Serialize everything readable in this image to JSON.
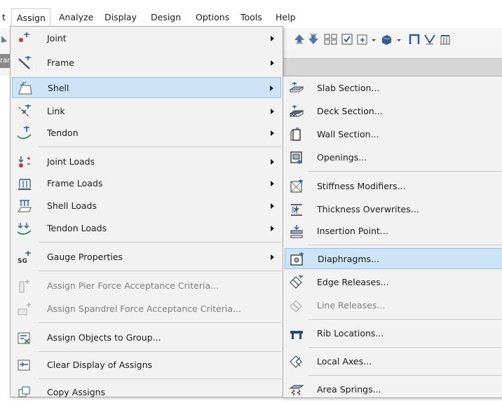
{
  "menubar": {
    "items": [
      {
        "label": "t"
      },
      {
        "label": "Assign"
      },
      {
        "label": "Analyze"
      },
      {
        "label": "Display"
      },
      {
        "label": "Design"
      },
      {
        "label": "Options"
      },
      {
        "label": "Tools"
      },
      {
        "label": "Help"
      }
    ]
  },
  "side_tab": {
    "label": "rar"
  },
  "assign_menu": {
    "items": [
      {
        "label": "Joint",
        "icon": "joint-icon",
        "submenu": true
      },
      {
        "label": "Frame",
        "icon": "frame-icon",
        "submenu": true
      },
      {
        "label": "Shell",
        "icon": "shell-icon",
        "submenu": true,
        "highlighted": true
      },
      {
        "label": "Link",
        "icon": "link-icon",
        "submenu": true
      },
      {
        "label": "Tendon",
        "icon": "tendon-icon",
        "submenu": true
      },
      {
        "label": "Joint Loads",
        "icon": "joint-loads-icon",
        "submenu": true
      },
      {
        "label": "Frame Loads",
        "icon": "frame-loads-icon",
        "submenu": true
      },
      {
        "label": "Shell Loads",
        "icon": "shell-loads-icon",
        "submenu": true
      },
      {
        "label": "Tendon Loads",
        "icon": "tendon-loads-icon",
        "submenu": true
      },
      {
        "label": "Gauge Properties",
        "icon": "gauge-icon",
        "submenu": true
      },
      {
        "label": "Assign Pier Force Acceptance Criteria...",
        "icon": "pier-icon",
        "disabled": true
      },
      {
        "label": "Assign Spandrel Force Acceptance Criteria...",
        "icon": "spandrel-icon",
        "disabled": true
      },
      {
        "label": "Assign Objects to Group...",
        "icon": "group-icon"
      },
      {
        "label": "Clear Display of Assigns",
        "icon": "clear-display-icon"
      },
      {
        "label": "Copy Assigns",
        "icon": "copy-assigns-icon"
      }
    ]
  },
  "shell_submenu": {
    "items": [
      {
        "label": "Slab Section...",
        "icon": "slab-section-icon"
      },
      {
        "label": "Deck Section...",
        "icon": "deck-section-icon"
      },
      {
        "label": "Wall Section...",
        "icon": "wall-section-icon"
      },
      {
        "label": "Openings...",
        "icon": "openings-icon"
      },
      {
        "label": "Stiffness Modifiers...",
        "icon": "stiffness-icon"
      },
      {
        "label": "Thickness Overwrites...",
        "icon": "thickness-icon"
      },
      {
        "label": "Insertion Point...",
        "icon": "insertion-point-icon"
      },
      {
        "label": "Diaphragms...",
        "icon": "diaphragms-icon",
        "highlighted": true
      },
      {
        "label": "Edge Releases...",
        "icon": "edge-releases-icon"
      },
      {
        "label": "Line Releases...",
        "icon": "line-releases-icon",
        "disabled": true
      },
      {
        "label": "Rib Locations...",
        "icon": "rib-locations-icon"
      },
      {
        "label": "Local Axes...",
        "icon": "local-axes-icon"
      },
      {
        "label": "Area Springs...",
        "icon": "area-springs-icon"
      }
    ]
  },
  "colors": {
    "highlight": "#cde4f7",
    "highlight_border": "#90c2ea",
    "menu_bg": "#f2f2f2"
  }
}
